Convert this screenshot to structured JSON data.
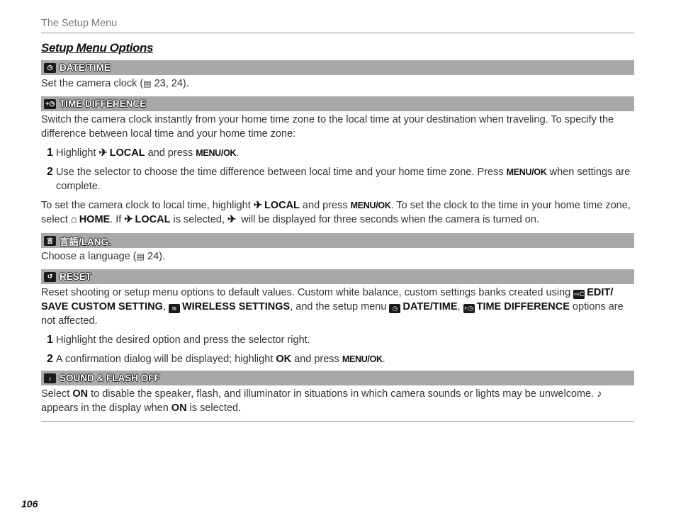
{
  "running_head": "The Setup Menu",
  "page_title": "Setup Menu Options",
  "page_number": "106",
  "icons": {
    "clock": "◷",
    "time_diff": "+◷",
    "lang": "言",
    "reset": "↺",
    "sound_flash": "♪",
    "edit": "⇨C",
    "wireless": "≋",
    "plane": "✈",
    "home": "⌂",
    "book": "▤"
  },
  "sections": {
    "date_time": {
      "title": "DATE/TIME",
      "text_pre": "Set the camera clock (",
      "text_post": " 23, 24)."
    },
    "time_difference": {
      "title": "TIME DIFFERENCE",
      "intro": "Switch the camera clock instantly from your home time zone to the local time at your destination when traveling.  To specify the difference between local time and your home time zone:",
      "step1": {
        "num": "1",
        "a": "Highlight ",
        "local": "LOCAL",
        "b": " and press ",
        "menu": "MENU/OK",
        "c": "."
      },
      "step2": {
        "num": "2",
        "a": "Use the selector to choose the time difference between local time and your home time zone.  Press ",
        "menu": "MENU/OK",
        "b": " when settings are complete."
      },
      "note": {
        "a": "To set the camera clock to local time, highlight ",
        "local": "LOCAL",
        "b": " and press ",
        "menu": "MENU/OK",
        "c": ".  To set the clock to the time in your home time zone, select ",
        "home": "HOME",
        "d": ".  If ",
        "e": " is selected, ",
        "f": " will be displayed for three seconds when the camera is turned on."
      }
    },
    "lang": {
      "title": "言語/LANG.",
      "text_pre": "Choose a language (",
      "text_post": " 24)."
    },
    "reset": {
      "title": "RESET",
      "intro_a": "Reset shooting or setup menu options to default values.  Custom white balance, custom settings banks created using ",
      "edit": "EDIT/ SAVE CUSTOM SETTING",
      "intro_b": ", ",
      "wireless": "WIRELESS SETTINGS",
      "intro_c": ", and the setup menu ",
      "datetime": "DATE/TIME",
      "intro_d": ", ",
      "timediff": "TIME DIFFERENCE",
      "intro_e": " options are not affected.",
      "step1": {
        "num": "1",
        "text": "Highlight the desired option and press the selector right."
      },
      "step2": {
        "num": "2",
        "a": "A confirmation dialog will be displayed; highlight ",
        "ok": "OK",
        "b": " and press ",
        "menu": "MENU/OK",
        "c": "."
      }
    },
    "sound_flash": {
      "title": "SOUND & FLASH OFF",
      "a": "Select ",
      "on1": "ON",
      "b": " to disable the speaker, flash, and illuminator in situations in which camera sounds or lights may be unwelcome. ",
      "c": " appears in the display when ",
      "on2": "ON",
      "d": " is selected."
    }
  }
}
